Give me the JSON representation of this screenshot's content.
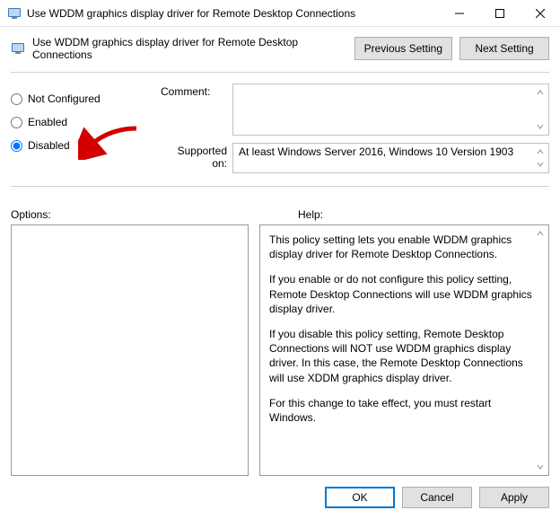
{
  "window": {
    "title": "Use WDDM graphics display driver for Remote Desktop Connections"
  },
  "header": {
    "title": "Use WDDM graphics display driver for Remote Desktop Connections",
    "previous_label": "Previous Setting",
    "next_label": "Next Setting"
  },
  "radios": {
    "not_configured": "Not Configured",
    "enabled": "Enabled",
    "disabled": "Disabled",
    "selected": "disabled"
  },
  "fields": {
    "comment_label": "Comment:",
    "comment_value": "",
    "supported_label": "Supported on:",
    "supported_value": "At least Windows Server 2016, Windows 10 Version 1903"
  },
  "sections": {
    "options_label": "Options:",
    "help_label": "Help:"
  },
  "help": {
    "p1": "This policy setting lets you enable WDDM graphics display driver for Remote Desktop Connections.",
    "p2": "If you enable or do not configure this policy setting, Remote Desktop Connections will use WDDM graphics display driver.",
    "p3": "If you disable this policy setting, Remote Desktop Connections will NOT use WDDM graphics display driver. In this case, the Remote Desktop Connections will use XDDM graphics display driver.",
    "p4": "For this change to take effect, you must restart Windows."
  },
  "footer": {
    "ok": "OK",
    "cancel": "Cancel",
    "apply": "Apply"
  }
}
